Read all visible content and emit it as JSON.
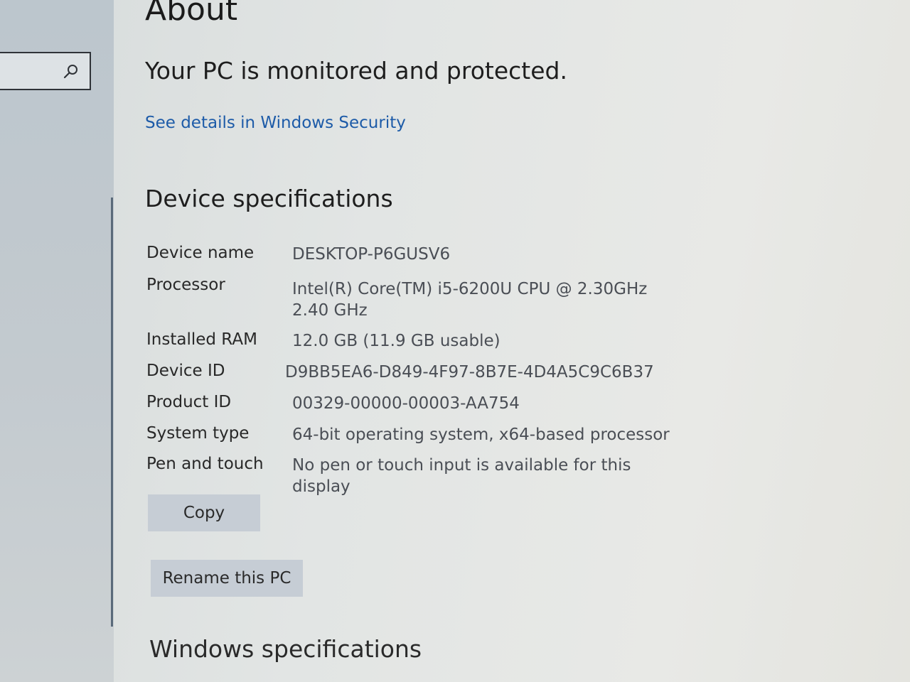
{
  "search": {
    "icon": "search-icon"
  },
  "page": {
    "title": "About"
  },
  "protection": {
    "heading": "Your PC is monitored and protected.",
    "link": "See details in Windows Security"
  },
  "device_specs": {
    "heading": "Device specifications",
    "rows": [
      {
        "label": "Device name",
        "value": "DESKTOP-P6GUSV6"
      },
      {
        "label": "Processor",
        "value": "Intel(R) Core(TM) i5-6200U CPU @ 2.30GHz   2.40 GHz"
      },
      {
        "label": "Installed RAM",
        "value": "12.0 GB (11.9 GB usable)"
      },
      {
        "label": "Device ID",
        "value": "D9BB5EA6-D849-4F97-8B7E-4D4A5C9C6B37"
      },
      {
        "label": "Product ID",
        "value": "00329-00000-00003-AA754"
      },
      {
        "label": "System type",
        "value": "64-bit operating system, x64-based processor"
      },
      {
        "label": "Pen and touch",
        "value": "No pen or touch input is available for this display"
      }
    ],
    "copy_label": "Copy",
    "rename_label": "Rename this PC"
  },
  "windows_specs": {
    "heading": "Windows specifications"
  },
  "colors": {
    "link": "#1d5ba8",
    "button_bg": "#c6cdd5",
    "sidebar_bg": "#bcc6cd"
  }
}
